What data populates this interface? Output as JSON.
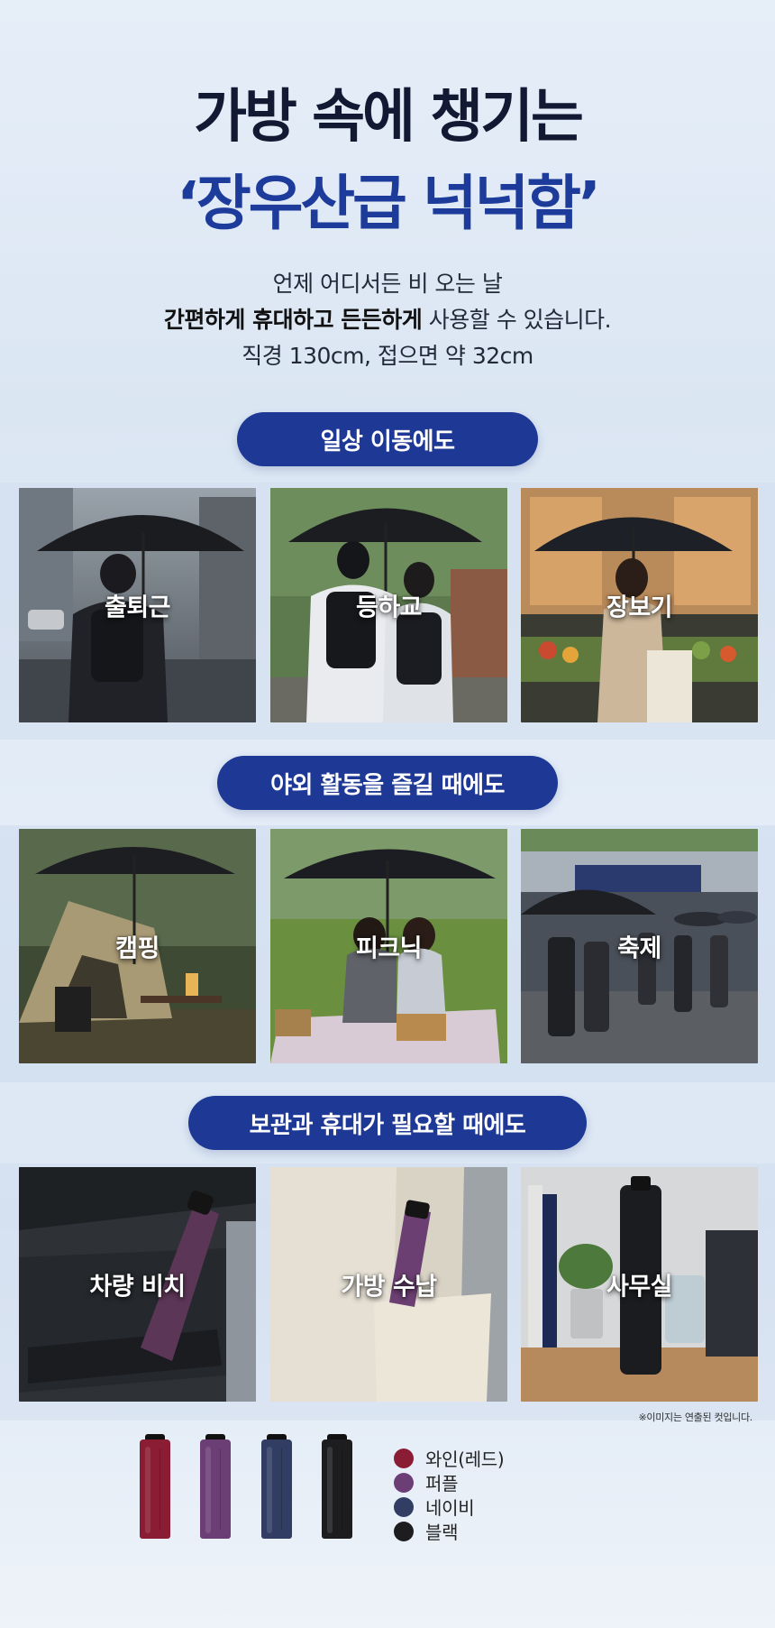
{
  "header": {
    "title_line1": "가방 속에 챙기는",
    "title_line2": "‘장우산급 넉넉함’"
  },
  "description": {
    "line1": "언제 어디서든 비 오는 날",
    "line2_bold": "간편하게 휴대하고 든든하게",
    "line2_rest": " 사용할 수 있습니다.",
    "line3": "직경 130cm, 접으면 약 32cm"
  },
  "sections": [
    {
      "title": "일상 이동에도",
      "tiles": [
        {
          "label": "출퇴근"
        },
        {
          "label": "등하교"
        },
        {
          "label": "장보기"
        }
      ]
    },
    {
      "title": "야외 활동을 즐길 때에도",
      "tiles": [
        {
          "label": "캠핑"
        },
        {
          "label": "피크닉"
        },
        {
          "label": "축제"
        }
      ]
    },
    {
      "title": "보관과 휴대가 필요할 때에도",
      "tiles": [
        {
          "label": "차량 비치"
        },
        {
          "label": "가방 수납"
        },
        {
          "label": "사무실"
        }
      ]
    }
  ],
  "image_note": "※이미지는 연출된 컷입니다.",
  "colors": [
    {
      "label": "와인(레드)",
      "hex": "#8a1c34"
    },
    {
      "label": "퍼플",
      "hex": "#6b3f75"
    },
    {
      "label": "네이비",
      "hex": "#323d63"
    },
    {
      "label": "블랙",
      "hex": "#1d1d20"
    }
  ]
}
